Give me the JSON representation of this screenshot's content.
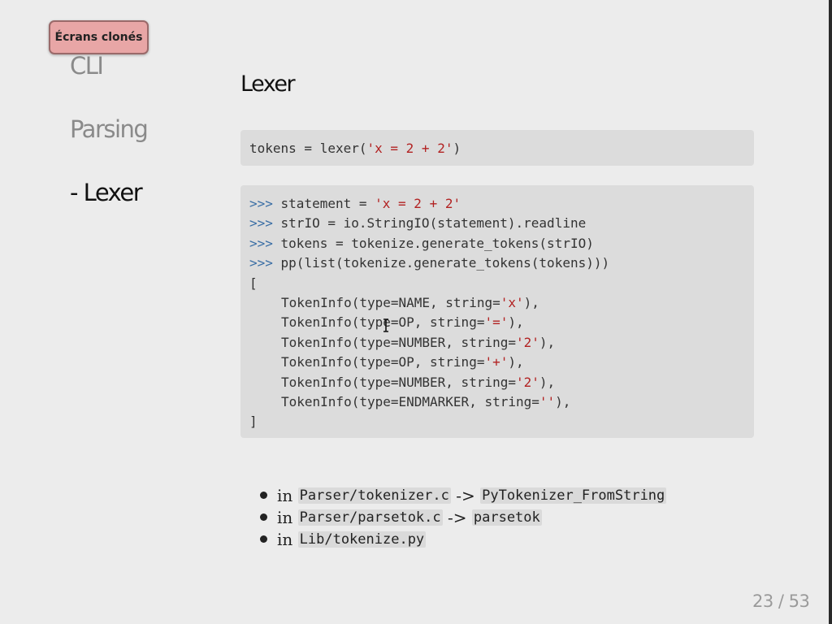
{
  "badge": {
    "label": "Écrans clonés"
  },
  "sidenav": {
    "items": [
      {
        "label": "CLI"
      },
      {
        "label": "Parsing"
      },
      {
        "label": "- Lexer"
      }
    ]
  },
  "main": {
    "title": "Lexer",
    "code1": {
      "prefix": "tokens = lexer(",
      "string": "'x = 2 + 2'",
      "suffix": ")"
    },
    "code2": {
      "prompt": ">>>",
      "l1_text": " statement = ",
      "l1_str": "'x = 2 + 2'",
      "l2_text": " strIO = io.StringIO(statement).readline",
      "l3_text": " tokens = tokenize.generate_tokens(strIO)",
      "l4_text": " pp(list(tokenize.generate_tokens(tokens)))",
      "open_bracket": "[",
      "tokens": [
        {
          "head": "TokenInfo(type=NAME, string=",
          "str": "'x'",
          "tail": "),"
        },
        {
          "head": "TokenInfo(type=OP, string=",
          "str": "'='",
          "tail": "),"
        },
        {
          "head": "TokenInfo(type=NUMBER, string=",
          "str": "'2'",
          "tail": "),"
        },
        {
          "head": "TokenInfo(type=OP, string=",
          "str": "'+'",
          "tail": "),"
        },
        {
          "head": "TokenInfo(type=NUMBER, string=",
          "str": "'2'",
          "tail": "),"
        },
        {
          "head": "TokenInfo(type=ENDMARKER, string=",
          "str": "''",
          "tail": "),"
        }
      ],
      "close_bracket": "]"
    },
    "bullets": [
      {
        "prefix": "in",
        "file": "Parser/tokenizer.c",
        "arrow": "->",
        "func": "PyTokenizer_FromString"
      },
      {
        "prefix": "in",
        "file": "Parser/parsetok.c",
        "arrow": "->",
        "func": "parsetok"
      },
      {
        "prefix": "in",
        "file": "Lib/tokenize.py"
      }
    ]
  },
  "footer": {
    "page": "23 / 53"
  },
  "colors": {
    "slide_bg": "#ececec",
    "code_bg": "#dcdcdc",
    "badge_bg": "#e8a6a6",
    "prompt": "#3a6ea5",
    "string": "#b22222",
    "nav_inactive": "#8a8a8a"
  },
  "icons": {
    "cursor": "text-cursor-icon"
  }
}
